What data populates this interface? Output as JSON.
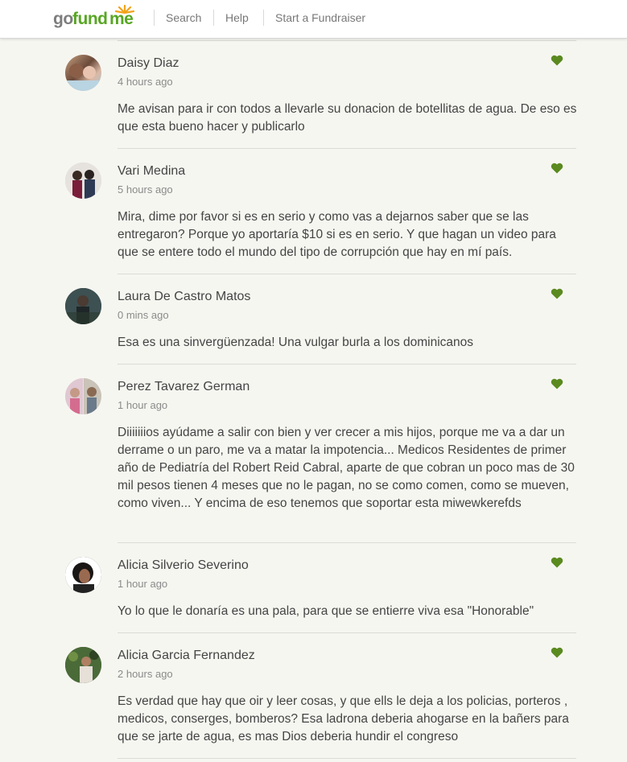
{
  "header": {
    "logo": {
      "go": "go",
      "fund": "fund",
      "me": "me"
    },
    "nav": [
      {
        "label": "Search"
      },
      {
        "label": "Help"
      },
      {
        "label": "Start a Fundraiser"
      }
    ]
  },
  "colors": {
    "brand_green": "#58a623",
    "heart_green": "#5a8a1f",
    "background": "#f6f6f1"
  },
  "comments": [
    {
      "name": "Daisy Diaz",
      "time": "4 hours ago",
      "text": "Me avisan para ir con todos a llevarle su donacion de botellitas de agua. De eso es que esta bueno hacer y publicarlo"
    },
    {
      "name": "Vari Medina",
      "time": "5 hours ago",
      "text": "Mira, dime por favor si es en serio y como vas a dejarnos saber que se las entregaron? Porque yo aportaría $10 si es en serio. Y que hagan un video para que se entere todo el mundo del tipo de corrupción que hay en mí país."
    },
    {
      "name": "Laura De Castro Matos",
      "time": "0 mins ago",
      "text": "Esa es una sinvergüenzada! Una vulgar burla a los dominicanos"
    },
    {
      "name": "Perez Tavarez German",
      "time": "1 hour ago",
      "text": "Diiiiiiios ayúdame a salir con bien y ver crecer a mis hijos, porque me va a dar un derrame o un paro, me va a matar la impotencia... Medicos Residentes de primer año de Pediatría del Robert Reid Cabral, aparte de que cobran un poco mas de 30 mil pesos tienen 4 meses que no le pagan, no se como comen, como se mueven, como viven... Y encima de eso tenemos que soportar esta miwewkerefds"
    },
    {
      "name": "Alicia Silverio Severino",
      "time": "1 hour ago",
      "text": "Yo lo que le donaría es una pala, para que se entierre viva esa \"Honorable\""
    },
    {
      "name": "Alicia Garcia Fernandez",
      "time": "2 hours ago",
      "text": "Es verdad que hay que oir y leer cosas, y que ells le deja a los policias, porteros , medicos, conserges, bomberos? Esa ladrona deberia ahogarse en la bañers para que se jarte de agua, es mas Dios deberia hundir el congreso"
    }
  ]
}
